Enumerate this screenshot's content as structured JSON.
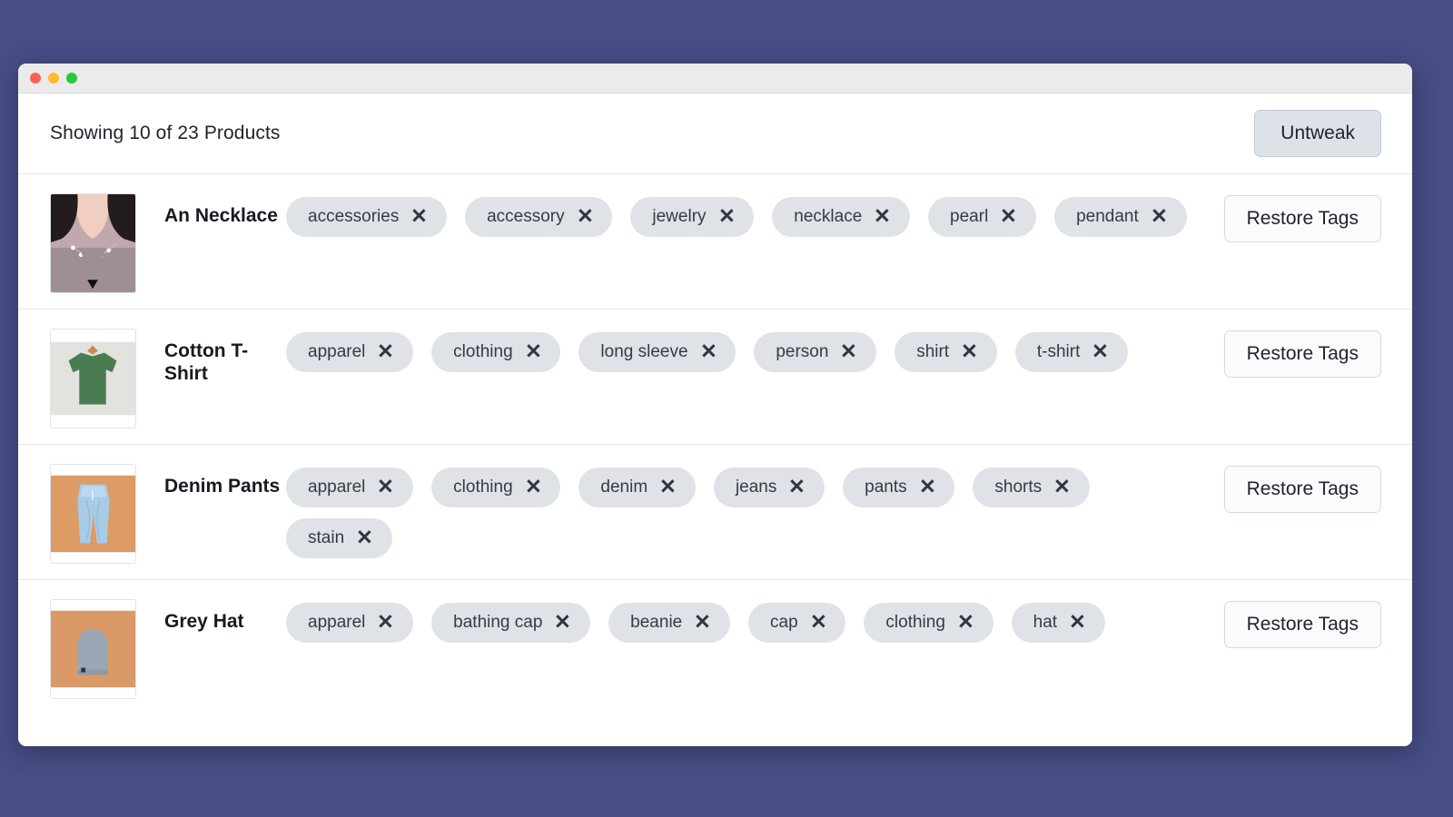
{
  "window": {
    "traffic_lights": [
      "close-red",
      "minimize-yellow",
      "maximize-green"
    ]
  },
  "toolbar": {
    "count_label": "Showing 10 of 23 Products",
    "untweak_label": "Untweak"
  },
  "colors": {
    "page_background": "#474d85",
    "titlebar": "#ebebeb",
    "window_background": "#ffffff",
    "tag_pill": "#dfe3e8",
    "untweak_button": "#dde1e8",
    "restore_button": "#fafbfc",
    "divider": "#e4e7ee",
    "traffic_red": "#ff5f57",
    "traffic_yellow": "#febc2e",
    "traffic_green": "#28c840"
  },
  "restore_label": "Restore Tags",
  "tag_remove_icon": "✕",
  "products": [
    {
      "name": "An Necklace",
      "image_alt": "pearl-necklace-photo",
      "tags": [
        "accessories",
        "accessory",
        "jewelry",
        "necklace",
        "pearl",
        "pendant"
      ]
    },
    {
      "name": "Cotton T-Shirt",
      "image_alt": "green-tshirt-photo",
      "tags": [
        "apparel",
        "clothing",
        "long sleeve",
        "person",
        "shirt",
        "t-shirt"
      ]
    },
    {
      "name": "Denim Pants",
      "image_alt": "blue-jeans-photo",
      "tags": [
        "apparel",
        "clothing",
        "denim",
        "jeans",
        "pants",
        "shorts",
        "stain"
      ]
    },
    {
      "name": "Grey Hat",
      "image_alt": "grey-beanie-photo",
      "tags": [
        "apparel",
        "bathing cap",
        "beanie",
        "cap",
        "clothing",
        "hat"
      ]
    }
  ]
}
